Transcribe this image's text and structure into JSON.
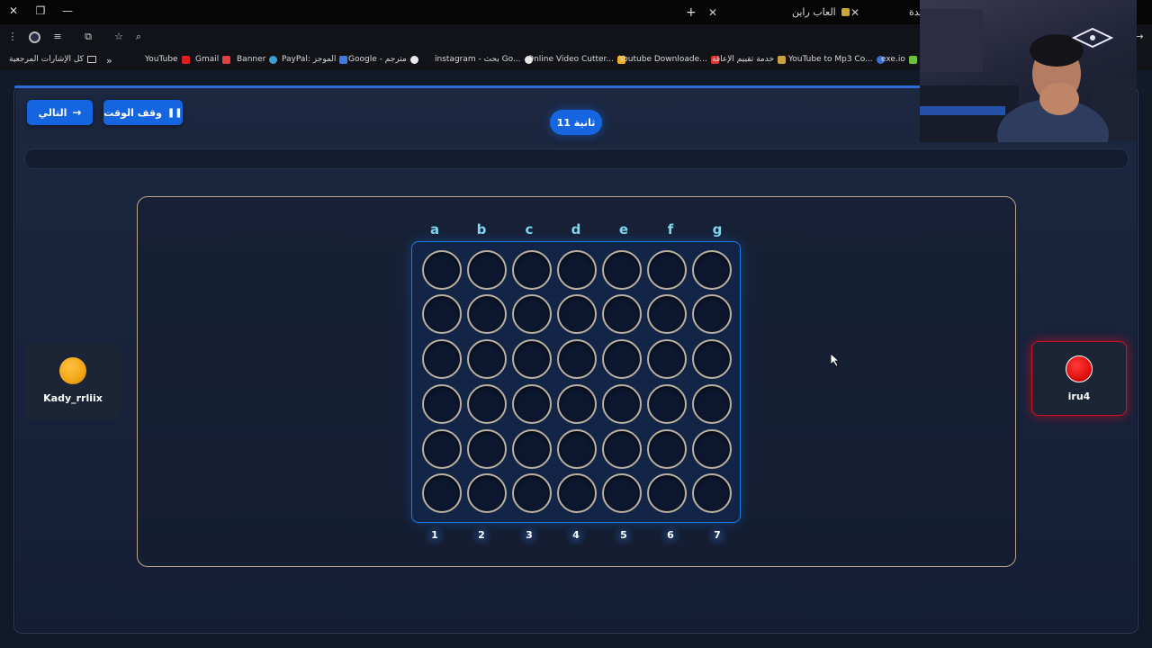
{
  "browser": {
    "tabs": [
      {
        "title": "العاب راين",
        "favicon_color": "#caa53a"
      },
      {
        "title": "يدة"
      }
    ],
    "bookmarks": [
      {
        "label": "exe.io",
        "color": "#6bbf3a"
      },
      {
        "label": "YouTube to Mp3 Co...",
        "color": "#3a6fd6"
      },
      {
        "label": "خدمة تقييم الإعاقة",
        "color": "#c9a040"
      },
      {
        "label": "Youtube Downloade...",
        "color": "#e03030"
      },
      {
        "label": "Online Video Cutter...",
        "color": "#f0b020"
      },
      {
        "label": "instagram - بحث Go...",
        "color": "#eaeaea"
      },
      {
        "label": "Google - مترجم",
        "color": "#eaeaea"
      },
      {
        "label": "PayPal: الموجز",
        "color": "#3a7be0"
      },
      {
        "label": "Banner",
        "color": "#3aa0d0"
      },
      {
        "label": "Gmail",
        "color": "#e04040"
      },
      {
        "label": "YouTube",
        "color": "#e02020"
      }
    ],
    "all_bookmarks_label": "كل الإشارات المرجعية",
    "more_bookmarks": "»"
  },
  "game": {
    "next_button": "التالي",
    "pause_button": "وقف الوقت",
    "timer": "11 ثانية",
    "columns": [
      "a",
      "b",
      "c",
      "d",
      "e",
      "f",
      "g"
    ],
    "row_numbers": [
      "1",
      "2",
      "3",
      "4",
      "5",
      "6",
      "7"
    ],
    "rows": 6,
    "player_left": {
      "name": "Kady_rrliix",
      "disc_color": "#f2a516"
    },
    "player_right": {
      "name": "iru4",
      "disc_color": "#e01010",
      "active": true
    }
  },
  "colors": {
    "accent": "#1565e0",
    "column_label": "#7fd8f0",
    "active_glow": "#d01020"
  }
}
